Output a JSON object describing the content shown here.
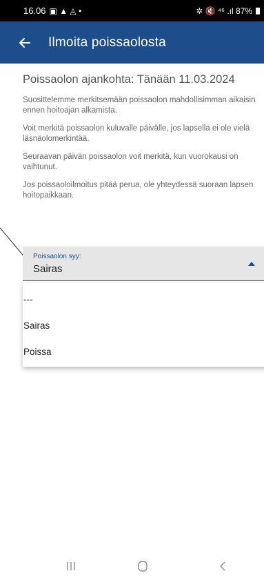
{
  "status_bar": {
    "time": "16.06",
    "extra_icons": "▣ ▲ ◬ •",
    "right_text": "✲ 🔇 ⁴⁶ .ıl 87%"
  },
  "app_bar": {
    "back_icon": "arrow-left-icon",
    "title": "Ilmoita poissaolosta"
  },
  "content": {
    "heading": "Poissaolon ajankohta: Tänään 11.03.2024",
    "paragraphs": [
      "Suosittelemme merkitsemään poissaolon mahdollisimman aikaisin ennen hoitoajan alkamista.",
      "Voit merkitä poissaolon kuluvalle päivälle, jos lapsella ei ole vielä läsnäolomerkintää.",
      "Seuraavan päivän poissaolon voit merkitä, kun vuorokausi on vaihtunut.",
      "Jos poissaoloilmoitus pitää perua, ole yhteydessä suoraan lapsen hoitopaikkaan."
    ]
  },
  "select": {
    "label": "Poissaolon syy:",
    "value": "Sairas",
    "options": [
      "---",
      "Sairas",
      "Poissa"
    ]
  },
  "nav_bar": {
    "icons": [
      "recent-apps-icon",
      "home-icon",
      "back-icon"
    ]
  },
  "colors": {
    "app_bar": "#1e4d8c",
    "accent": "#1e4d8c",
    "status_bar": "#000000"
  }
}
